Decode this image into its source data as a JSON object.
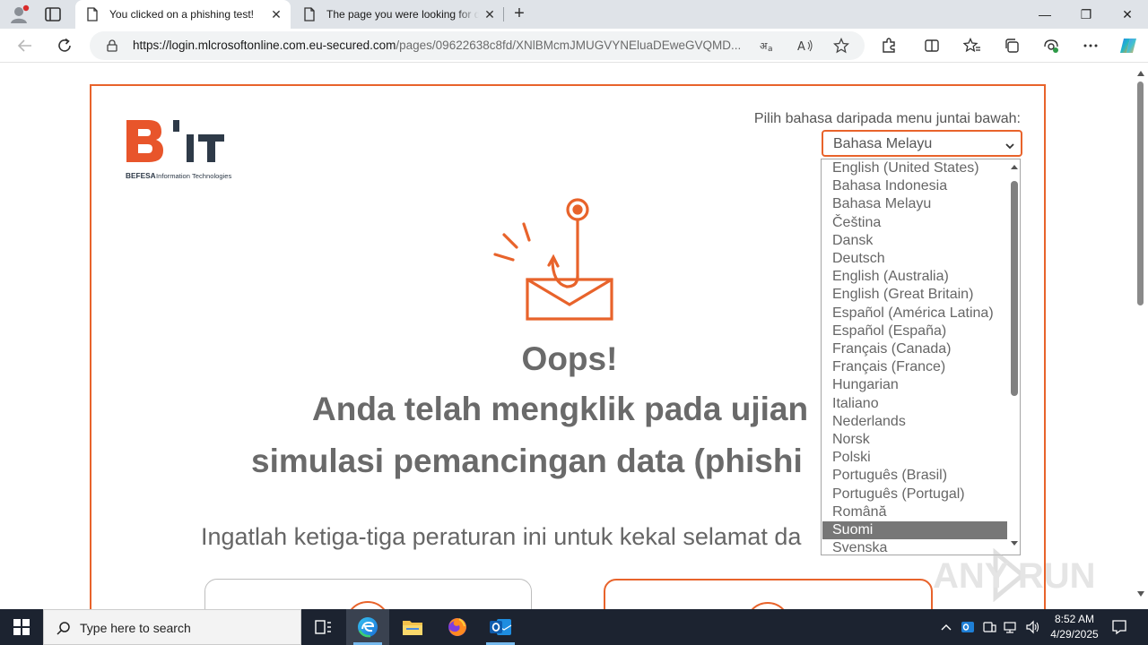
{
  "browser": {
    "tabs": [
      {
        "title": "You clicked on a phishing test!",
        "active": true
      },
      {
        "title": "The page you were looking for doesn't exist",
        "active": false
      }
    ],
    "url_domain": "https://login.mlcrosoftonline.com.eu-secured.com",
    "url_path": "/pages/09622638c8fd/XNlBMcmJMUGVYNEluaDEweGVQMD...",
    "window_controls": {
      "minimize": "—",
      "maximize": "❐",
      "close": "✕"
    }
  },
  "page": {
    "logo": {
      "letters": "B'IT",
      "subtitle": "BEFESA Information Technologies"
    },
    "language_label": "Pilih bahasa daripada menu juntai bawah:",
    "language_selected": "Bahasa Melayu",
    "language_options": [
      "English (United States)",
      "Bahasa Indonesia",
      "Bahasa Melayu",
      "Čeština",
      "Dansk",
      "Deutsch",
      "English (Australia)",
      "English (Great Britain)",
      "Español (América Latina)",
      "Español (España)",
      "Français (Canada)",
      "Français (France)",
      "Hungarian",
      "Italiano",
      "Nederlands",
      "Norsk",
      "Polski",
      "Português (Brasil)",
      "Português (Portugal)",
      "Română",
      "Suomi",
      "Svenska"
    ],
    "highlighted_option": "Suomi",
    "heading": "Oops!",
    "message_line1": "Anda telah mengklik pada ujian",
    "message_line2": "simulasi pemancingan data (phishi",
    "rules_text": "Ingatlah ketiga-tiga peraturan ini untuk kekal selamat da"
  },
  "watermark": "ANY RUN",
  "taskbar": {
    "search_placeholder": "Type here to search",
    "time": "8:52 AM",
    "date": "4/29/2025"
  },
  "colors": {
    "accent": "#e8632b",
    "text_gray": "#6a6a6a",
    "taskbar": "#1c2330"
  }
}
